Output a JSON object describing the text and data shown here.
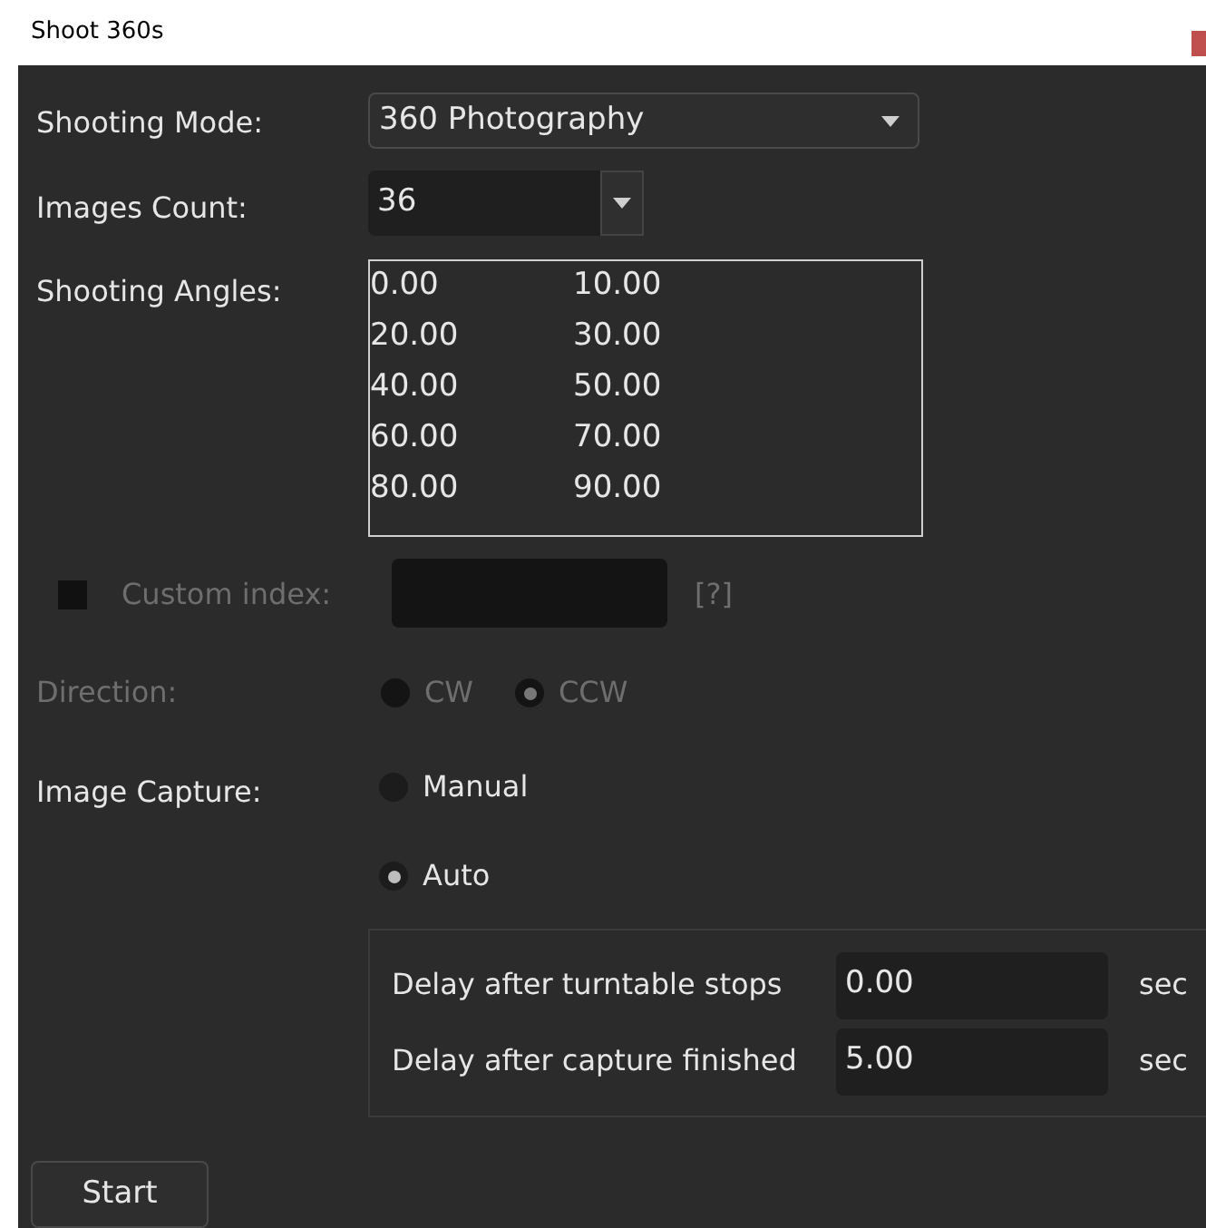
{
  "window": {
    "title": "Shoot 360s"
  },
  "shooting_mode": {
    "label": "Shooting Mode:",
    "value": "360 Photography"
  },
  "images_count": {
    "label": "Images Count:",
    "value": "36"
  },
  "shooting_angles": {
    "label": "Shooting Angles:",
    "rows": [
      [
        "0.00",
        "10.00"
      ],
      [
        "20.00",
        "30.00"
      ],
      [
        "40.00",
        "50.00"
      ],
      [
        "60.00",
        "70.00"
      ],
      [
        "80.00",
        "90.00"
      ]
    ]
  },
  "custom_index": {
    "label": "Custom index:",
    "checked": false,
    "disabled": true,
    "help": "[?]"
  },
  "direction": {
    "label": "Direction:",
    "disabled": true,
    "options": [
      {
        "label": "CW",
        "selected": false
      },
      {
        "label": "CCW",
        "selected": true
      }
    ]
  },
  "image_capture": {
    "label": "Image Capture:",
    "options": [
      {
        "label": "Manual",
        "selected": false
      },
      {
        "label": "Auto",
        "selected": true
      }
    ]
  },
  "delays": [
    {
      "label": "Delay after turntable stops",
      "value": "0.00",
      "unit": "sec"
    },
    {
      "label": "Delay after capture finished",
      "value": "5.00",
      "unit": "sec"
    }
  ],
  "start_button": "Start"
}
